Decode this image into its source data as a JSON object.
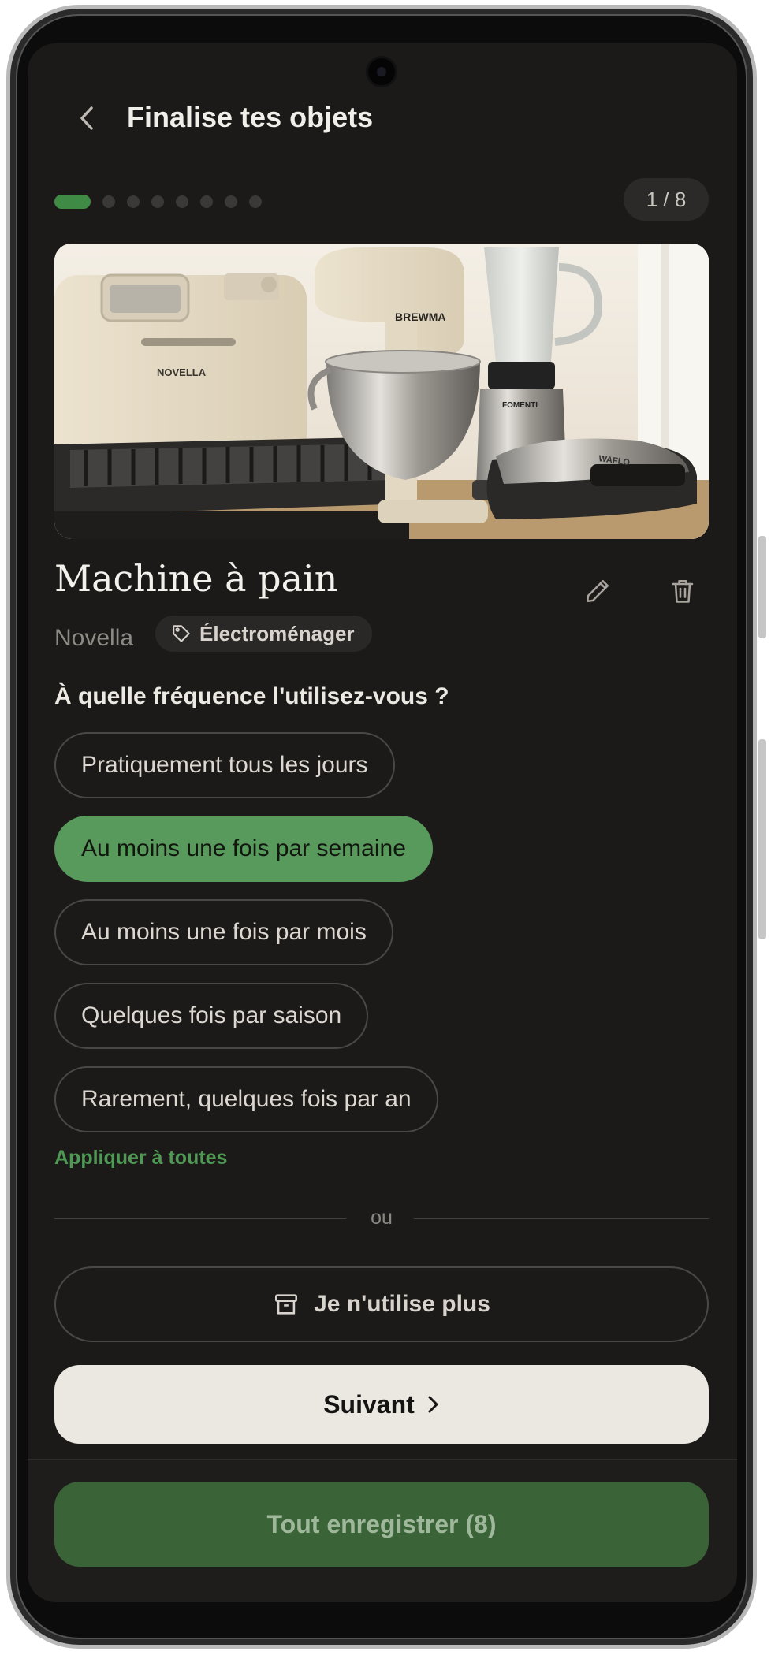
{
  "header": {
    "title": "Finalise tes objets",
    "back_icon": "chevron-left-icon"
  },
  "progress": {
    "total_steps": 8,
    "current_step": 1,
    "counter_text": "1 / 8",
    "accent": "#3f8a45"
  },
  "item": {
    "name": "Machine à pain",
    "brand": "Novella",
    "category": "Électroménager",
    "photo_labels": {
      "bread_machine": "NOVELLA",
      "mixer": "BREWMA",
      "blender": "FOMENTI",
      "sandwich_press": "WAFLO"
    }
  },
  "question": "À quelle fréquence l'utilisez-vous ?",
  "options": [
    {
      "label": "Pratiquement tous les jours",
      "selected": false
    },
    {
      "label": "Au moins une fois par semaine",
      "selected": true
    },
    {
      "label": "Au moins une fois par mois",
      "selected": false
    },
    {
      "label": "Quelques fois par saison",
      "selected": false
    },
    {
      "label": "Rarement, quelques fois par an",
      "selected": false
    }
  ],
  "apply_all_label": "Appliquer à toutes",
  "or_label": "ou",
  "no_longer_used_label": "Je n'utilise plus",
  "next_label": "Suivant",
  "save_all_label": "Tout enregistrer (8)",
  "colors": {
    "background": "#1c1a19",
    "selected": "#579a5c",
    "save_button": "#3a6337"
  }
}
